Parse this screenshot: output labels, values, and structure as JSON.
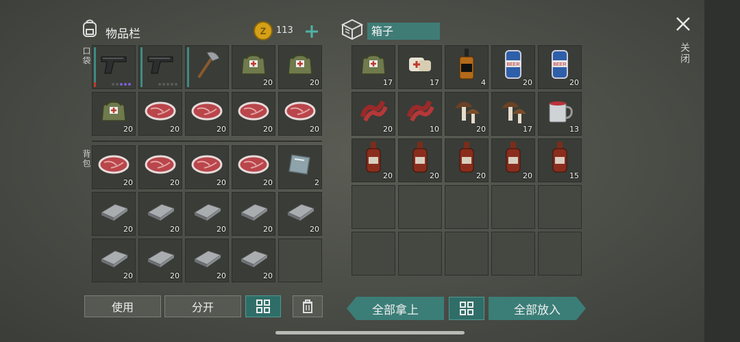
{
  "inventory": {
    "title": "物品栏",
    "pocket_label": "口袋",
    "backpack_label": "背包",
    "coins": "113",
    "pocket_slots": [
      {
        "icon": "pistol-icon",
        "count": ""
      },
      {
        "icon": "pistol-icon",
        "count": ""
      },
      {
        "icon": "axe-icon",
        "count": ""
      },
      {
        "icon": "medkit-bag-icon",
        "count": "20"
      },
      {
        "icon": "medkit-bag-icon",
        "count": "20"
      },
      {
        "icon": "medkit-bag-icon",
        "count": "20"
      },
      {
        "icon": "raw-meat-icon",
        "count": "20"
      },
      {
        "icon": "raw-meat-icon",
        "count": "20"
      },
      {
        "icon": "raw-meat-icon",
        "count": "20"
      },
      {
        "icon": "raw-meat-icon",
        "count": "20"
      }
    ],
    "backpack_slots": [
      {
        "icon": "raw-meat-icon",
        "count": "20"
      },
      {
        "icon": "raw-meat-icon",
        "count": "20"
      },
      {
        "icon": "raw-meat-icon",
        "count": "20"
      },
      {
        "icon": "raw-meat-icon",
        "count": "20"
      },
      {
        "icon": "glass-sheet-icon",
        "count": "2"
      },
      {
        "icon": "iron-bar-icon",
        "count": "20"
      },
      {
        "icon": "iron-bar-icon",
        "count": "20"
      },
      {
        "icon": "iron-bar-icon",
        "count": "20"
      },
      {
        "icon": "iron-bar-icon",
        "count": "20"
      },
      {
        "icon": "iron-bar-icon",
        "count": "20"
      },
      {
        "icon": "iron-bar-icon",
        "count": "20"
      },
      {
        "icon": "iron-bar-icon",
        "count": "20"
      },
      {
        "icon": "iron-bar-icon",
        "count": "20"
      },
      {
        "icon": "iron-bar-icon",
        "count": "20"
      },
      {
        "icon": "",
        "count": ""
      }
    ],
    "buttons": {
      "use": "使用",
      "split": "分开"
    }
  },
  "box": {
    "title": "箱子",
    "slots": [
      {
        "icon": "medkit-bag-icon",
        "count": "17"
      },
      {
        "icon": "bandage-icon",
        "count": "17"
      },
      {
        "icon": "whiskey-bottle-icon",
        "count": "4"
      },
      {
        "icon": "beer-can-icon",
        "count": "20"
      },
      {
        "icon": "beer-can-icon",
        "count": "20"
      },
      {
        "icon": "bacon-icon",
        "count": "20"
      },
      {
        "icon": "bacon-icon",
        "count": "10"
      },
      {
        "icon": "mushroom-icon",
        "count": "20"
      },
      {
        "icon": "mushroom-icon",
        "count": "17"
      },
      {
        "icon": "mug-icon",
        "count": "13"
      },
      {
        "icon": "medicine-bottle-icon",
        "count": "20"
      },
      {
        "icon": "medicine-bottle-icon",
        "count": "20"
      },
      {
        "icon": "medicine-bottle-icon",
        "count": "20"
      },
      {
        "icon": "medicine-bottle-icon",
        "count": "20"
      },
      {
        "icon": "medicine-bottle-icon",
        "count": "15"
      }
    ],
    "buttons": {
      "take_all": "全部拿上",
      "put_all": "全部放入"
    }
  },
  "close_label": "关闭",
  "colors": {
    "accent": "#3b7e77",
    "slot": "#3a3c37",
    "meat": "#c94a4a",
    "iron": "#8e9296"
  }
}
